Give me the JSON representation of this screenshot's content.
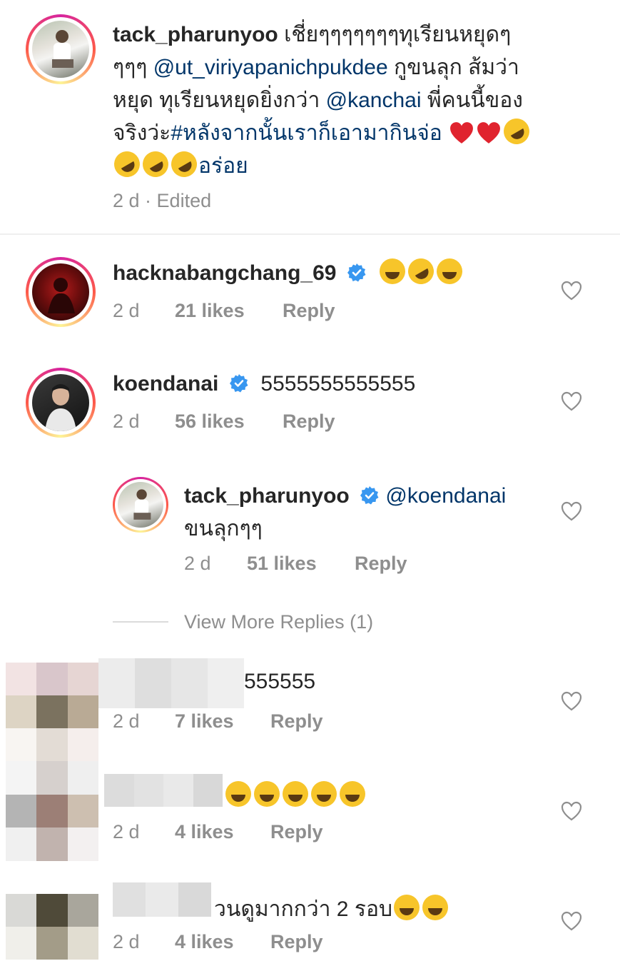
{
  "post": {
    "username": "tack_pharunyoo",
    "caption_part1": " เชี่ยๆๆๆๆๆๆๆทุเรียนหยุดๆ",
    "caption_line2_prefix": "ๆๆๆ ",
    "mention1": "@ut_viriyapanichpukdee",
    "caption_line2_suffix": " กูขนลุก ส้มว่า",
    "caption_line3_prefix": "หยุด ทุเรียนหยุดยิ่งกว่า ",
    "mention2": "@kanchai",
    "caption_line3_suffix": " พี่คนนี้ของ",
    "caption_line4_prefix": "จริงว่ะ",
    "hashtag": "#หลังจากนั้นเราก็เอามากินจ่อ",
    "caption_line5_suffix": "อร่อย",
    "time": "2 d",
    "edited": " · Edited"
  },
  "comments": [
    {
      "username": "hacknabangchang_69",
      "time": "2 d",
      "likes": "21 likes",
      "reply": "Reply"
    },
    {
      "username": "koendanai",
      "text": "5555555555555",
      "time": "2 d",
      "likes": "56 likes",
      "reply": "Reply"
    },
    {
      "username": "tack_pharunyoo",
      "mention": "@koendanai",
      "text": "ขนลุกๆๆ",
      "time": "2 d",
      "likes": "51 likes",
      "reply": "Reply"
    }
  ],
  "view_more": "View More Replies (1)",
  "blurred_comments": [
    {
      "text": "555555",
      "time": "2 d",
      "likes": "7 likes",
      "reply": "Reply"
    },
    {
      "text": "",
      "time": "2 d",
      "likes": "4 likes",
      "reply": "Reply"
    },
    {
      "text": "วนดูมากกว่า 2 รอบ",
      "time": "2 d",
      "likes": "4 likes",
      "reply": "Reply"
    }
  ]
}
